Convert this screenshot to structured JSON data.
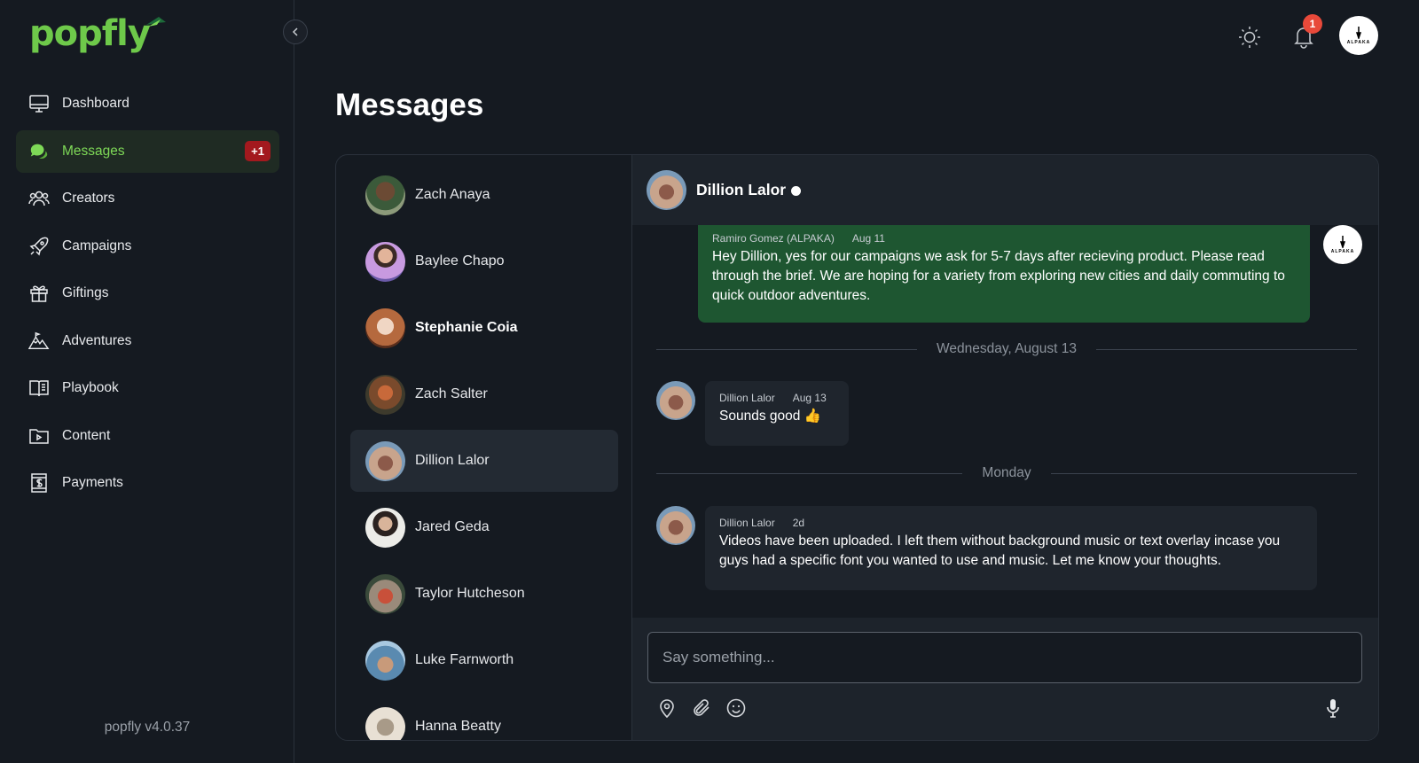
{
  "app": {
    "logo": "popfly",
    "version": "popfly v4.0.37",
    "brand_color": "#7ed957"
  },
  "sidebar": {
    "items": [
      {
        "label": "Dashboard",
        "icon": "monitor-icon"
      },
      {
        "label": "Messages",
        "icon": "chat-icon",
        "badge": "+1",
        "active": true
      },
      {
        "label": "Creators",
        "icon": "users-icon"
      },
      {
        "label": "Campaigns",
        "icon": "rocket-icon"
      },
      {
        "label": "Giftings",
        "icon": "gift-icon"
      },
      {
        "label": "Adventures",
        "icon": "mountain-icon"
      },
      {
        "label": "Playbook",
        "icon": "book-icon"
      },
      {
        "label": "Content",
        "icon": "video-folder-icon"
      },
      {
        "label": "Payments",
        "icon": "dollar-icon"
      }
    ]
  },
  "topbar": {
    "notification_count": "1",
    "account_logo_text": "ALPAKA"
  },
  "page": {
    "title": "Messages"
  },
  "contacts": [
    {
      "name": "Zach Anaya",
      "bold": false
    },
    {
      "name": "Baylee Chapo",
      "bold": false
    },
    {
      "name": "Stephanie Coia",
      "bold": true
    },
    {
      "name": "Zach Salter",
      "bold": false
    },
    {
      "name": "Dillion Lalor",
      "bold": false,
      "selected": true
    },
    {
      "name": "Jared Geda",
      "bold": false
    },
    {
      "name": "Taylor Hutcheson",
      "bold": false
    },
    {
      "name": "Luke Farnworth",
      "bold": false
    },
    {
      "name": "Hanna Beatty",
      "bold": false
    }
  ],
  "chat": {
    "contact_name": "Dillion Lalor",
    "messages": [
      {
        "sender": "Ramiro Gomez (ALPAKA)",
        "time": "Aug 11",
        "text": "Hey Dillion, yes for our campaigns we ask for 5-7 days after recieving product. Please read through the brief. We are hoping for a variety from exploring new cities and daily commuting to quick outdoor adventures."
      },
      {
        "sender": "Dillion Lalor",
        "time": "Aug 13",
        "text": "Sounds good 👍"
      },
      {
        "sender": "Dillion Lalor",
        "time": "2d",
        "text": "Videos have been uploaded. I left them without background music or text overlay incase you guys had a specific font you wanted to use and music. Let me know your thoughts."
      }
    ],
    "dividers": [
      "Wednesday, August 13",
      "Monday"
    ],
    "composer_placeholder": "Say something..."
  }
}
